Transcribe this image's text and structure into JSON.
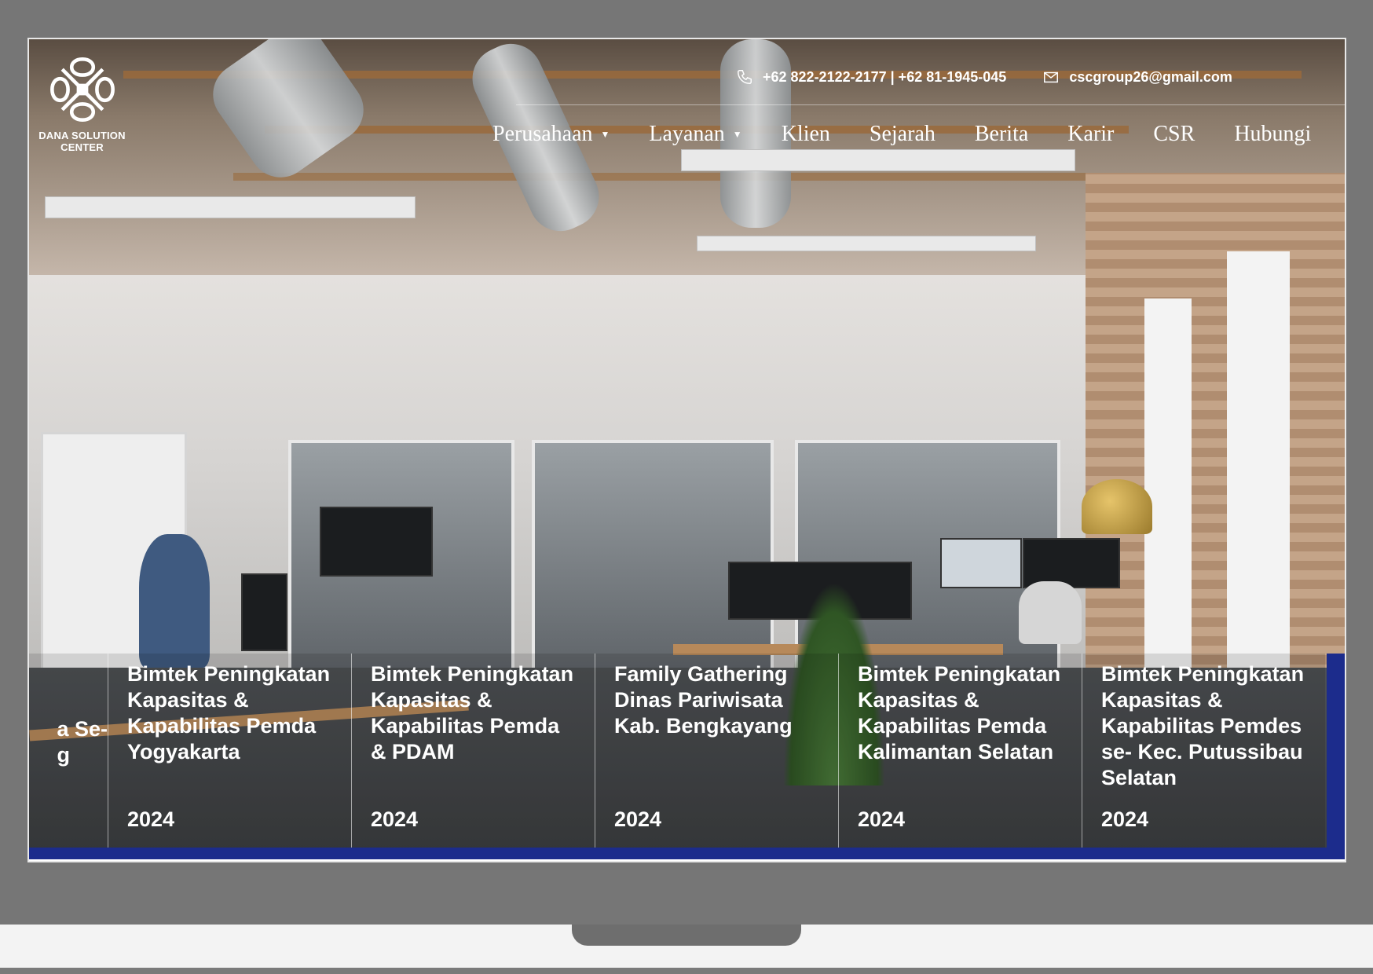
{
  "brand": {
    "logo_text_line1": "DANA SOLUTION",
    "logo_text_line2": "CENTER"
  },
  "topbar": {
    "phone": "+62 822-2122-2177 | +62 81-1945-045",
    "email": "cscgroup26@gmail.com"
  },
  "nav": {
    "items": [
      {
        "label": "Perusahaan",
        "has_dropdown": true
      },
      {
        "label": "Layanan",
        "has_dropdown": true
      },
      {
        "label": "Klien",
        "has_dropdown": false
      },
      {
        "label": "Sejarah",
        "has_dropdown": false
      },
      {
        "label": "Berita",
        "has_dropdown": false
      },
      {
        "label": "Karir",
        "has_dropdown": false
      },
      {
        "label": "CSR",
        "has_dropdown": false
      },
      {
        "label": "Hubungi",
        "has_dropdown": false
      }
    ]
  },
  "news": {
    "partial_card": {
      "line1": "a Se-",
      "line2": "g"
    },
    "cards": [
      {
        "title": "Bimtek Peningkatan Kapasitas & Kapabilitas Pemda Yogyakarta",
        "year": "2024"
      },
      {
        "title": "Bimtek Peningkatan Kapasitas & Kapabilitas Pemda & PDAM",
        "year": "2024"
      },
      {
        "title": "Family Gathering Dinas Pariwisata Kab. Bengkayang",
        "year": "2024"
      },
      {
        "title": "Bimtek Peningkatan Kapasitas & Kapabilitas Pemda Kalimantan Selatan",
        "year": "2024"
      },
      {
        "title": "Bimtek Peningkatan Kapasitas & Kapabilitas Pemdes se- Kec. Putussibau Selatan",
        "year": "2024"
      }
    ]
  },
  "colors": {
    "accent_blue": "#1c2c8c",
    "text_white": "#ffffff"
  },
  "icons": {
    "phone": "phone-icon",
    "email": "envelope-icon",
    "dropdown": "caret-down-icon"
  }
}
